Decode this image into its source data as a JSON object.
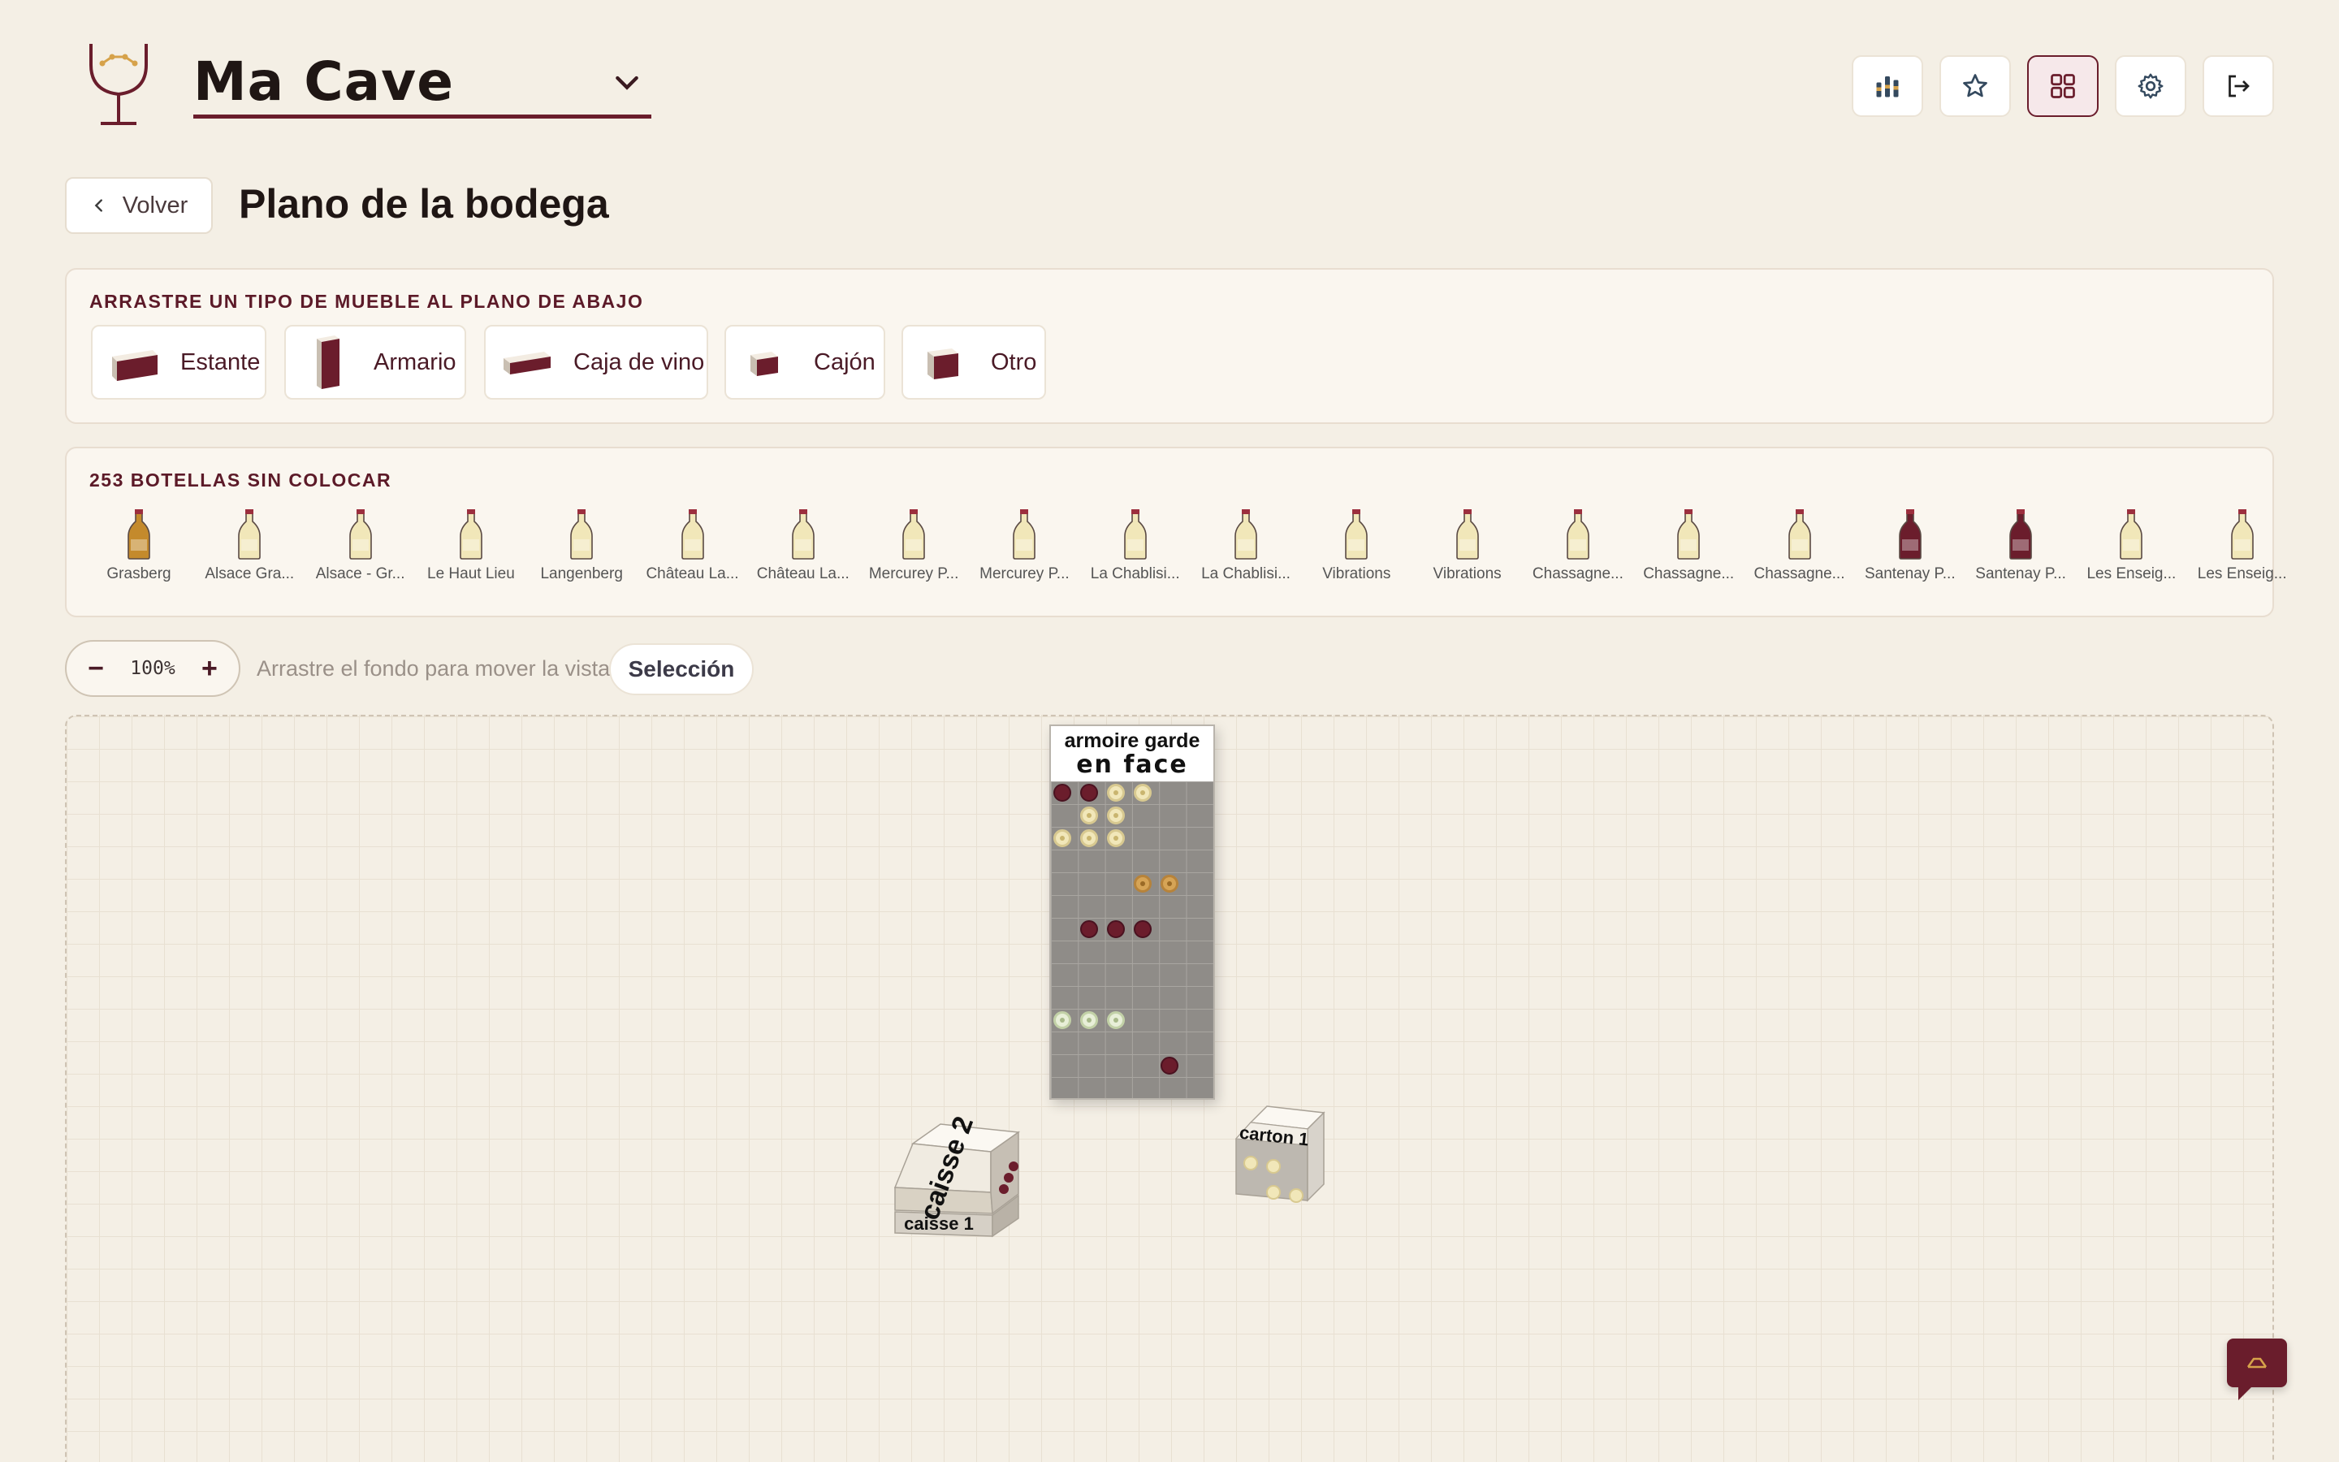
{
  "header": {
    "cellar_name": "Ma Cave",
    "buttons": [
      {
        "name": "stats-button",
        "icon": "bar-chart-icon"
      },
      {
        "name": "favorites-button",
        "icon": "star-icon"
      },
      {
        "name": "cellar-plan-button",
        "icon": "grid-icon",
        "active": true
      },
      {
        "name": "settings-button",
        "icon": "gear-icon"
      },
      {
        "name": "logout-button",
        "icon": "logout-icon"
      }
    ]
  },
  "title_row": {
    "back_label": "Volver",
    "page_title": "Plano de la bodega"
  },
  "furniture_panel": {
    "label": "ARRASTRE UN TIPO DE MUEBLE AL PLANO DE ABAJO",
    "items": [
      {
        "label": "Estante",
        "icon": "shelf-icon"
      },
      {
        "label": "Armario",
        "icon": "cabinet-icon"
      },
      {
        "label": "Caja de vino",
        "icon": "wine-case-icon"
      },
      {
        "label": "Cajón",
        "icon": "drawer-icon"
      },
      {
        "label": "Otro",
        "icon": "other-box-icon"
      }
    ]
  },
  "bottles_panel": {
    "label": "253 BOTELLAS SIN COLOCAR",
    "bottles": [
      {
        "name": "Grasberg",
        "color": "#c48a2c"
      },
      {
        "name": "Alsace Gra...",
        "color": "#f1e7b9"
      },
      {
        "name": "Alsace - Gr...",
        "color": "#f1e7b9"
      },
      {
        "name": "Le Haut Lieu",
        "color": "#f1e7b9"
      },
      {
        "name": "Langenberg",
        "color": "#f1e7b9"
      },
      {
        "name": "Château La...",
        "color": "#f1e7b9"
      },
      {
        "name": "Château La...",
        "color": "#f1e7b9"
      },
      {
        "name": "Mercurey P...",
        "color": "#f1e7b9"
      },
      {
        "name": "Mercurey P...",
        "color": "#f1e7b9"
      },
      {
        "name": "La Chablisi...",
        "color": "#f1e7b9"
      },
      {
        "name": "La Chablisi...",
        "color": "#f1e7b9"
      },
      {
        "name": "Vibrations",
        "color": "#f1e7b9"
      },
      {
        "name": "Vibrations",
        "color": "#f1e7b9"
      },
      {
        "name": "Chassagne...",
        "color": "#f1e7b9"
      },
      {
        "name": "Chassagne...",
        "color": "#f1e7b9"
      },
      {
        "name": "Chassagne...",
        "color": "#f1e7b9"
      },
      {
        "name": "Santenay P...",
        "color": "#6b1d2c"
      },
      {
        "name": "Santenay P...",
        "color": "#6b1d2c"
      },
      {
        "name": "Les Enseig...",
        "color": "#f1e7b9"
      },
      {
        "name": "Les Enseig...",
        "color": "#f1e7b9"
      }
    ]
  },
  "zoom": {
    "minus": "−",
    "value": "100%",
    "plus": "+",
    "hint": "Arrastre el fondo para mover la vista",
    "select_label": "Selección"
  },
  "canvas": {
    "armoire": {
      "label_line1": "armoire garde",
      "label_line2": "en face"
    },
    "crate_top_label": "caisse 2",
    "crate_bottom_label": "caisse 1",
    "carton_label": "carton 1"
  },
  "colors": {
    "accent": "#6a1d2c",
    "background": "#f4efe5",
    "red_wine": "#6b1d2c",
    "white_wine": "#f1e7b9",
    "sweet_wine": "#d6a456"
  }
}
